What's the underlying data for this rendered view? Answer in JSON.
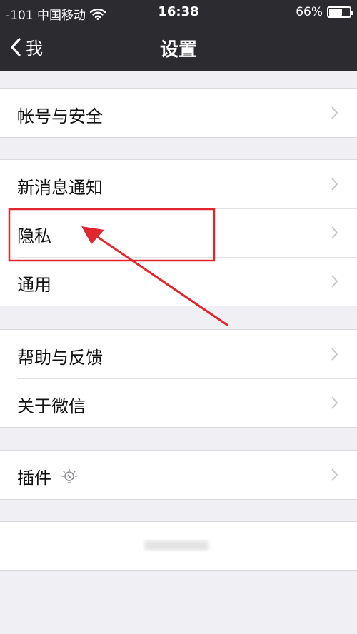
{
  "status_bar": {
    "carrier": "-101 中国移动",
    "time": "16:38",
    "battery": "66%",
    "battery_level": 0.66
  },
  "nav": {
    "back_label": "我",
    "title": "设置"
  },
  "groups": [
    [
      {
        "label": "帐号与安全"
      }
    ],
    [
      {
        "label": "新消息通知"
      },
      {
        "label": "隐私"
      },
      {
        "label": "通用"
      }
    ],
    [
      {
        "label": "帮助与反馈"
      },
      {
        "label": "关于微信"
      }
    ],
    [
      {
        "label": "插件"
      }
    ]
  ],
  "colors": {
    "topbar": "#2b2b30",
    "background": "#efeff4",
    "annotation": "#e0262f",
    "chevron": "#c7c7cc"
  }
}
